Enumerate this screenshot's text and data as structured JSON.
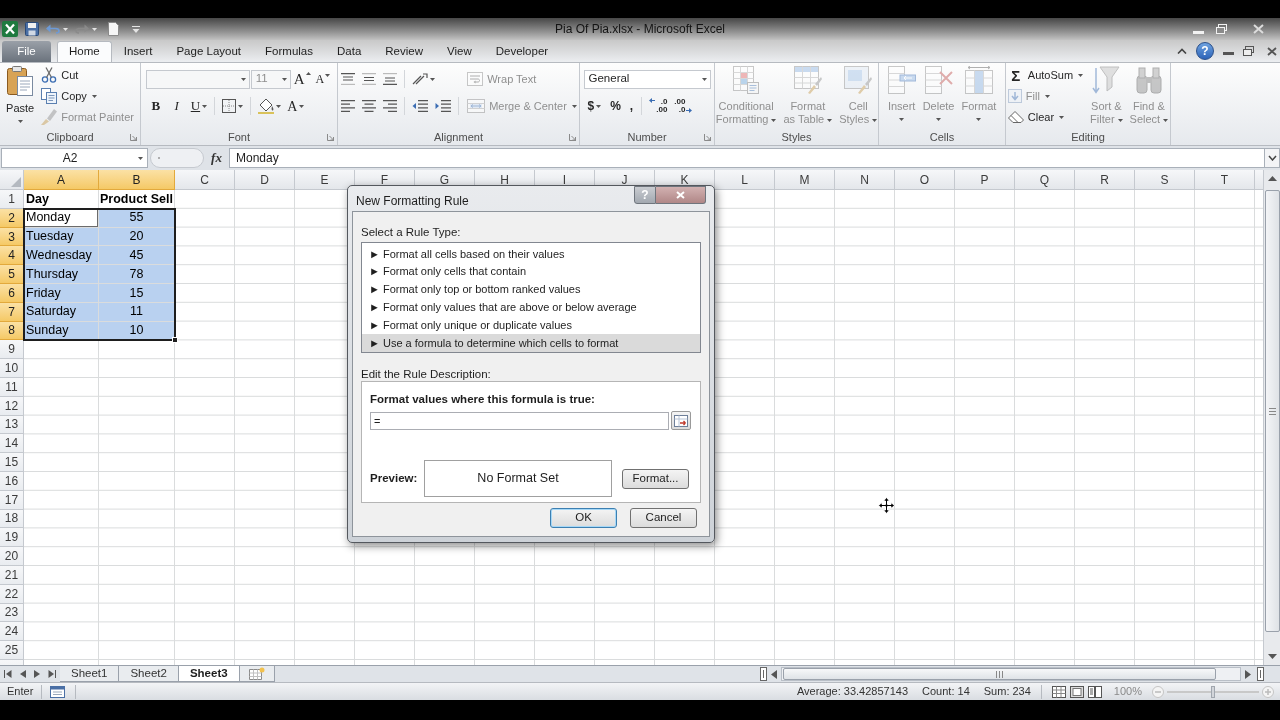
{
  "window": {
    "title": "Pia Of Pia.xlsx - Microsoft Excel"
  },
  "ribbon_tabs": [
    {
      "label": "File",
      "kind": "file",
      "selected": false
    },
    {
      "label": "Home",
      "kind": "tab",
      "selected": true
    },
    {
      "label": "Insert",
      "kind": "tab",
      "selected": false
    },
    {
      "label": "Page Layout",
      "kind": "tab",
      "selected": false
    },
    {
      "label": "Formulas",
      "kind": "tab",
      "selected": false
    },
    {
      "label": "Data",
      "kind": "tab",
      "selected": false
    },
    {
      "label": "Review",
      "kind": "tab",
      "selected": false
    },
    {
      "label": "View",
      "kind": "tab",
      "selected": false
    },
    {
      "label": "Developer",
      "kind": "tab",
      "selected": false
    }
  ],
  "help_button": "?",
  "ribbon_groups": [
    {
      "label": "Clipboard",
      "launcher": true,
      "columns": [
        {
          "kind": "large",
          "label": "Paste",
          "dropdown": true,
          "disabled": false
        },
        {
          "kind": "stack",
          "rows": [
            [
              {
                "kind": "small",
                "label": "Cut",
                "dropdown": false,
                "disabled": false
              }
            ],
            [
              {
                "kind": "small",
                "label": "Copy",
                "dropdown": true,
                "disabled": false
              }
            ],
            [
              {
                "kind": "small",
                "label": "Format Painter",
                "dropdown": false,
                "disabled": true
              }
            ]
          ]
        }
      ]
    },
    {
      "label": "Font",
      "launcher": true,
      "columns": [
        {
          "kind": "stack",
          "rows": [
            [
              {
                "kind": "combo",
                "dropdown": true,
                "disabled": true
              },
              {
                "kind": "combo",
                "value": "11",
                "dropdown": true,
                "disabled": true
              },
              {
                "kind": "grow",
                "label": "A",
                "dropdown": false,
                "disabled": false
              },
              {
                "kind": "shrink",
                "label": "A",
                "dropdown": false,
                "disabled": false
              }
            ],
            [
              {
                "kind": "bold",
                "label": "B",
                "dropdown": false,
                "disabled": false
              },
              {
                "kind": "italic",
                "label": "I",
                "dropdown": false,
                "disabled": false
              },
              {
                "kind": "underline",
                "label": "U",
                "dropdown": true,
                "disabled": false
              },
              {
                "kind": "separator"
              },
              {
                "kind": "icon",
                "dropdown": true,
                "disabled": false
              },
              {
                "kind": "separator"
              },
              {
                "kind": "icon",
                "dropdown": true,
                "disabled": false
              },
              {
                "kind": "font_color",
                "label": "A",
                "dropdown": true,
                "disabled": false
              }
            ]
          ]
        }
      ]
    },
    {
      "label": "Alignment",
      "launcher": true,
      "columns": [
        {
          "kind": "stack",
          "rows": [
            [
              {
                "kind": "icon",
                "dropdown": false,
                "disabled": false
              },
              {
                "kind": "icon",
                "dropdown": false,
                "disabled": false
              },
              {
                "kind": "icon",
                "dropdown": false,
                "disabled": false
              },
              {
                "kind": "separator"
              },
              {
                "kind": "icon",
                "dropdown": true,
                "disabled": false
              }
            ],
            [
              {
                "kind": "icon",
                "dropdown": false,
                "disabled": false
              },
              {
                "kind": "icon",
                "dropdown": false,
                "disabled": false
              },
              {
                "kind": "icon",
                "dropdown": false,
                "disabled": false
              },
              {
                "kind": "separator"
              },
              {
                "kind": "icon",
                "dropdown": false,
                "disabled": false
              },
              {
                "kind": "icon",
                "dropdown": false,
                "disabled": false
              },
              {
                "kind": "separator"
              }
            ]
          ]
        },
        {
          "kind": "stack",
          "rows": [
            [
              {
                "kind": "small",
                "label": "Wrap Text",
                "dropdown": false,
                "disabled": true
              }
            ],
            [
              {
                "kind": "small",
                "label": "Merge & Center",
                "dropdown": true,
                "disabled": true
              }
            ]
          ]
        }
      ]
    },
    {
      "label": "Number",
      "launcher": true,
      "columns": [
        {
          "kind": "stack",
          "rows": [
            [
              {
                "kind": "combo",
                "value": "General",
                "dropdown": true,
                "disabled": false
              }
            ],
            [
              {
                "kind": "glyph",
                "label": "$",
                "dropdown": true,
                "disabled": false
              },
              {
                "kind": "glyph",
                "label": "%",
                "dropdown": false,
                "disabled": false
              },
              {
                "kind": "glyph",
                "label": ",",
                "dropdown": false,
                "disabled": false
              },
              {
                "kind": "separator"
              },
              {
                "kind": "decimal",
                "lines": [
                  ".0",
                  ".00"
                ],
                "dropdown": false,
                "disabled": false
              },
              {
                "kind": "decimal",
                "lines": [
                  ".00",
                  ".0"
                ],
                "dropdown": false,
                "disabled": false
              }
            ]
          ]
        }
      ]
    },
    {
      "label": "Styles",
      "launcher": false,
      "columns": [
        {
          "kind": "large",
          "label": "Conditional\nFormatting",
          "dropdown": true,
          "disabled": true
        },
        {
          "kind": "large",
          "label": "Format\nas Table",
          "dropdown": true,
          "disabled": true
        },
        {
          "kind": "large",
          "label": "Cell\nStyles",
          "dropdown": true,
          "disabled": true
        }
      ]
    },
    {
      "label": "Cells",
      "launcher": false,
      "columns": [
        {
          "kind": "large",
          "label": "Insert",
          "dropdown": true,
          "disabled": true
        },
        {
          "kind": "large",
          "label": "Delete",
          "dropdown": true,
          "disabled": true
        },
        {
          "kind": "large",
          "label": "Format",
          "dropdown": true,
          "disabled": true
        }
      ]
    },
    {
      "label": "Editing",
      "launcher": false,
      "columns": [
        {
          "kind": "stack",
          "rows": [
            [
              {
                "kind": "small",
                "glyph": "Σ",
                "label": "AutoSum",
                "dropdown": true,
                "disabled": false
              }
            ],
            [
              {
                "kind": "small",
                "label": "Fill",
                "dropdown": true,
                "disabled": true
              }
            ],
            [
              {
                "kind": "small",
                "label": "Clear",
                "dropdown": true,
                "disabled": false
              }
            ]
          ]
        },
        {
          "kind": "large",
          "label": "Sort &\nFilter",
          "dropdown": true,
          "disabled": true
        },
        {
          "kind": "large",
          "label": "Find &\nSelect",
          "dropdown": true,
          "disabled": true
        }
      ]
    }
  ],
  "formula_bar": {
    "name_box": "A2",
    "function_button": "fx",
    "formula": "Monday"
  },
  "sheet": {
    "columns": [
      {
        "label": "A",
        "selected": true
      },
      {
        "label": "B",
        "selected": true
      },
      {
        "label": "C",
        "selected": false
      },
      {
        "label": "D",
        "selected": false
      },
      {
        "label": "E",
        "selected": false
      },
      {
        "label": "F",
        "selected": false
      },
      {
        "label": "G",
        "selected": false
      },
      {
        "label": "H",
        "selected": false
      },
      {
        "label": "I",
        "selected": false
      },
      {
        "label": "J",
        "selected": false
      },
      {
        "label": "K",
        "selected": false
      },
      {
        "label": "L",
        "selected": false
      },
      {
        "label": "M",
        "selected": false
      },
      {
        "label": "N",
        "selected": false
      },
      {
        "label": "O",
        "selected": false
      },
      {
        "label": "P",
        "selected": false
      },
      {
        "label": "Q",
        "selected": false
      },
      {
        "label": "R",
        "selected": false
      },
      {
        "label": "S",
        "selected": false
      },
      {
        "label": "T",
        "selected": false
      }
    ],
    "rows": [
      {
        "label": "1",
        "selected": false,
        "cells": [
          {
            "value": "Day",
            "bold": true,
            "selected": false,
            "active": false
          },
          {
            "value": "Product Sell",
            "bold": true,
            "selected": false,
            "active": false
          }
        ]
      },
      {
        "label": "2",
        "selected": true,
        "cells": [
          {
            "value": "Monday",
            "bold": false,
            "selected": true,
            "active": true
          },
          {
            "value": "55",
            "bold": false,
            "selected": true,
            "active": false
          }
        ]
      },
      {
        "label": "3",
        "selected": true,
        "cells": [
          {
            "value": "Tuesday",
            "bold": false,
            "selected": true,
            "active": false
          },
          {
            "value": "20",
            "bold": false,
            "selected": true,
            "active": false
          }
        ]
      },
      {
        "label": "4",
        "selected": true,
        "cells": [
          {
            "value": "Wednesday",
            "bold": false,
            "selected": true,
            "active": false
          },
          {
            "value": "45",
            "bold": false,
            "selected": true,
            "active": false
          }
        ]
      },
      {
        "label": "5",
        "selected": true,
        "cells": [
          {
            "value": "Thursday",
            "bold": false,
            "selected": true,
            "active": false
          },
          {
            "value": "78",
            "bold": false,
            "selected": true,
            "active": false
          }
        ]
      },
      {
        "label": "6",
        "selected": true,
        "cells": [
          {
            "value": "Friday",
            "bold": false,
            "selected": true,
            "active": false
          },
          {
            "value": "15",
            "bold": false,
            "selected": true,
            "active": false
          }
        ]
      },
      {
        "label": "7",
        "selected": true,
        "cells": [
          {
            "value": "Saturday",
            "bold": false,
            "selected": true,
            "active": false
          },
          {
            "value": "11",
            "bold": false,
            "selected": true,
            "active": false
          }
        ]
      },
      {
        "label": "8",
        "selected": true,
        "cells": [
          {
            "value": "Sunday",
            "bold": false,
            "selected": true,
            "active": false
          },
          {
            "value": "10",
            "bold": false,
            "selected": true,
            "active": false
          }
        ]
      },
      {
        "label": "9",
        "selected": false
      },
      {
        "label": "10",
        "selected": false
      },
      {
        "label": "11",
        "selected": false
      },
      {
        "label": "12",
        "selected": false
      },
      {
        "label": "13",
        "selected": false
      },
      {
        "label": "14",
        "selected": false
      },
      {
        "label": "15",
        "selected": false
      },
      {
        "label": "16",
        "selected": false
      },
      {
        "label": "17",
        "selected": false
      },
      {
        "label": "18",
        "selected": false
      },
      {
        "label": "19",
        "selected": false
      },
      {
        "label": "20",
        "selected": false
      },
      {
        "label": "21",
        "selected": false
      },
      {
        "label": "22",
        "selected": false
      },
      {
        "label": "23",
        "selected": false
      },
      {
        "label": "24",
        "selected": false
      },
      {
        "label": "25",
        "selected": false
      }
    ]
  },
  "sheet_tabs": [
    {
      "label": "Sheet1",
      "selected": false
    },
    {
      "label": "Sheet2",
      "selected": false
    },
    {
      "label": "Sheet3",
      "selected": true
    }
  ],
  "status_bar": {
    "mode": "Enter",
    "average": "Average: 33.42857143",
    "count": "Count: 14",
    "sum": "Sum: 234",
    "zoom": "100%",
    "zoom_slider": {
      "level": 0.5
    }
  },
  "dialog": {
    "title": "New Formatting Rule",
    "help_button": "?",
    "rule_type_label": "Select a Rule Type:",
    "rule_types": [
      {
        "label": "► Format all cells based on their values",
        "selected": false
      },
      {
        "label": "► Format only cells that contain",
        "selected": false
      },
      {
        "label": "► Format only top or bottom ranked values",
        "selected": false
      },
      {
        "label": "► Format only values that are above or below average",
        "selected": false
      },
      {
        "label": "► Format only unique or duplicate values",
        "selected": false
      },
      {
        "label": "► Use a formula to determine which cells to format",
        "selected": true
      }
    ],
    "description_label": "Edit the Rule Description:",
    "formula_label": "Format values where this formula is true:",
    "formula_field": {
      "value": "="
    },
    "preview_label": "Preview:",
    "preview_text": "No Format Set",
    "format_button": "Format...",
    "buttons": [
      {
        "label": "OK",
        "focused": true
      },
      {
        "label": "Cancel",
        "focused": false
      }
    ]
  }
}
